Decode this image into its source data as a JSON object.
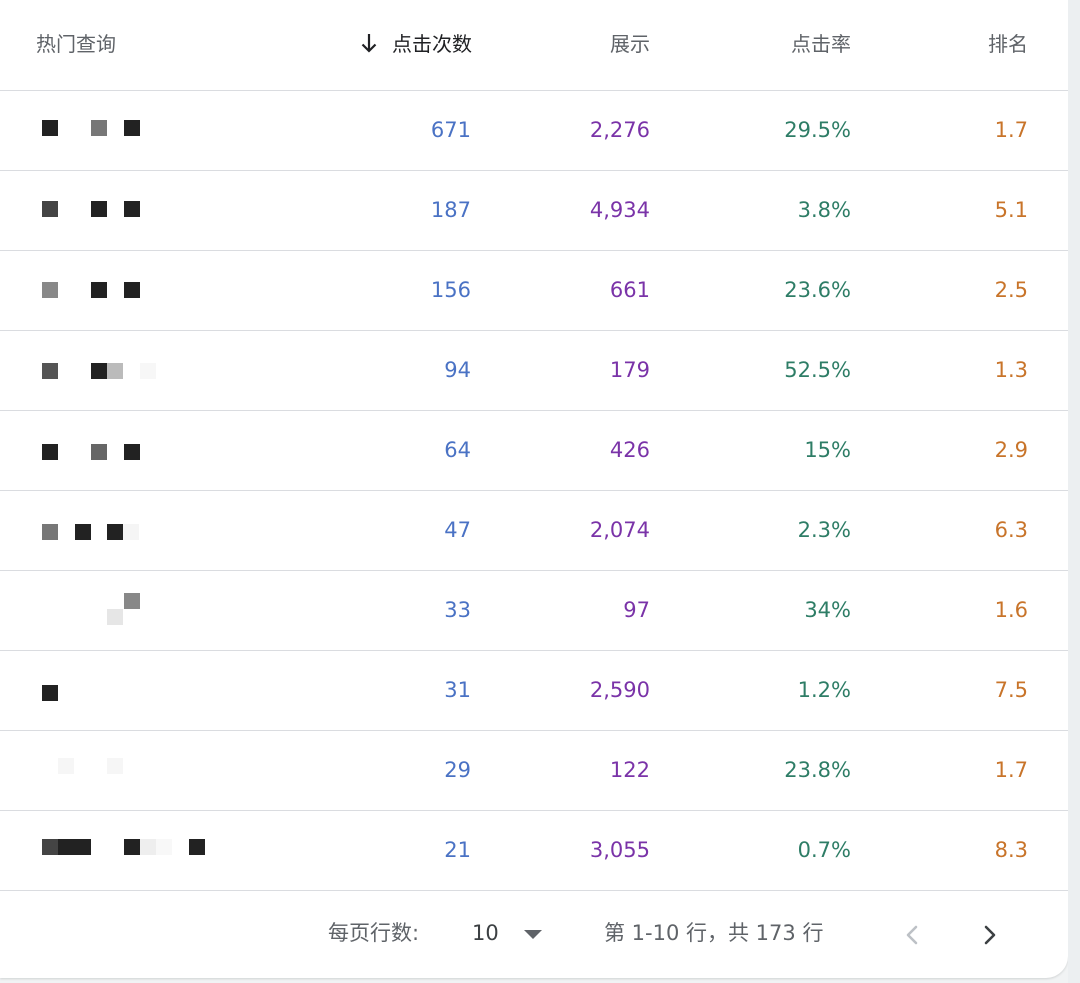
{
  "table": {
    "columns": {
      "query": "热门查询",
      "clicks": "点击次数",
      "impressions": "展示",
      "ctr": "点击率",
      "position": "排名"
    },
    "sort": {
      "column": "clicks",
      "direction": "descending",
      "icon": "arrow-down-icon"
    },
    "rows": [
      {
        "clicks": "671",
        "impressions": "2,276",
        "ctr": "29.5%",
        "position": "1.7"
      },
      {
        "clicks": "187",
        "impressions": "4,934",
        "ctr": "3.8%",
        "position": "5.1"
      },
      {
        "clicks": "156",
        "impressions": "661",
        "ctr": "23.6%",
        "position": "2.5"
      },
      {
        "clicks": "94",
        "impressions": "179",
        "ctr": "52.5%",
        "position": "1.3"
      },
      {
        "clicks": "64",
        "impressions": "426",
        "ctr": "15%",
        "position": "2.9"
      },
      {
        "clicks": "47",
        "impressions": "2,074",
        "ctr": "2.3%",
        "position": "6.3"
      },
      {
        "clicks": "33",
        "impressions": "97",
        "ctr": "34%",
        "position": "1.6"
      },
      {
        "clicks": "31",
        "impressions": "2,590",
        "ctr": "1.2%",
        "position": "7.5"
      },
      {
        "clicks": "29",
        "impressions": "122",
        "ctr": "23.8%",
        "position": "1.7"
      },
      {
        "clicks": "21",
        "impressions": "3,055",
        "ctr": "0.7%",
        "position": "8.3"
      }
    ]
  },
  "pagination": {
    "rows_per_page_label": "每页行数:",
    "rows_per_page_value": "10",
    "range_text": "第 1-10 行，共 173 行",
    "prev_icon": "chevron-left-icon",
    "next_icon": "chevron-right-icon"
  },
  "colors": {
    "clicks": "#4a72c4",
    "impressions": "#7a33a8",
    "ctr": "#2e7d66",
    "position": "#c8742a",
    "divider": "#dadce0"
  }
}
